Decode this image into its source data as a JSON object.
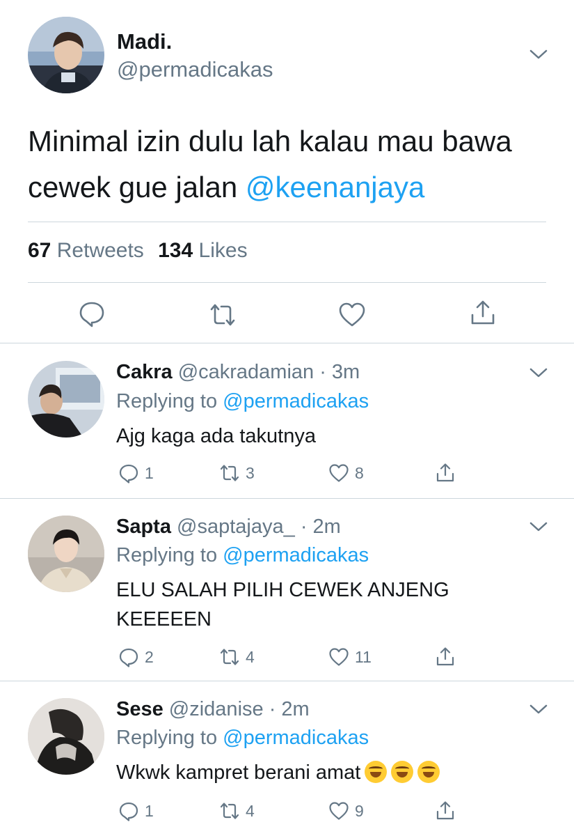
{
  "tweet": {
    "name": "Madi.",
    "handle": "@permadicakas",
    "text_plain": "Minimal izin dulu lah kalau mau bawa cewek gue jalan ",
    "text_mention": "@keenanjaya",
    "retweets_count": "67",
    "retweets_label": "Retweets",
    "likes_count": "134",
    "likes_label": "Likes",
    "actions": [
      "reply-icon",
      "retweet-icon",
      "like-icon",
      "share-icon"
    ]
  },
  "replies": [
    {
      "name": "Cakra",
      "handle": "@cakradamian",
      "time": "· 3m",
      "replying_prefix": "Replying to ",
      "replying_to": "@permadicakas",
      "text": "Ajg kaga ada takutnya",
      "reply_count": "1",
      "retweet_count": "3",
      "like_count": "8"
    },
    {
      "name": "Sapta",
      "handle": "@saptajaya_",
      "time": "· 2m",
      "replying_prefix": "Replying to ",
      "replying_to": "@permadicakas",
      "text": "ELU SALAH PILIH CEWEK ANJENG KEEEEEN",
      "reply_count": "2",
      "retweet_count": "4",
      "like_count": "11"
    },
    {
      "name": "Sese",
      "handle": "@zidanise",
      "time": "· 2m",
      "replying_prefix": "Replying to ",
      "replying_to": "@permadicakas",
      "text": "Wkwk kampret berani amat",
      "emojis": "🤣🤣🤣",
      "reply_count": "1",
      "retweet_count": "4",
      "like_count": "9"
    }
  ],
  "colors": {
    "accent": "#1da1f2",
    "text": "#14171a",
    "secondary": "#657786",
    "divider": "#ccd6dd"
  }
}
